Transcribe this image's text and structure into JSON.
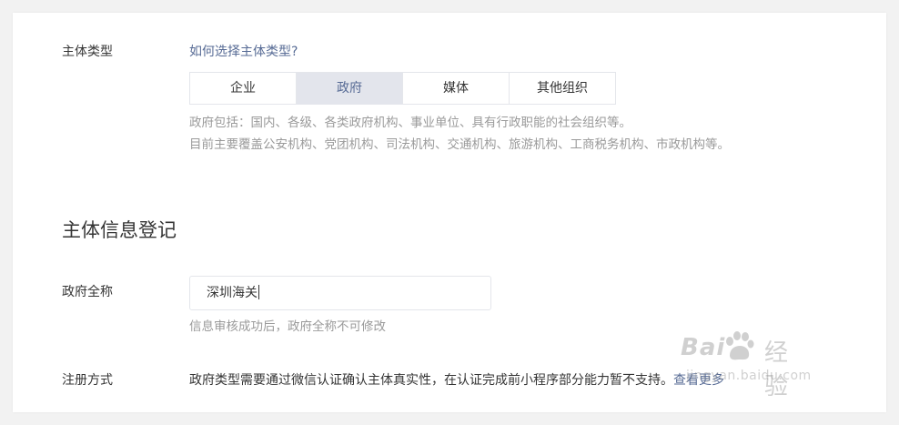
{
  "entity_type": {
    "label": "主体类型",
    "help_link": "如何选择主体类型?",
    "tabs": [
      "企业",
      "政府",
      "媒体",
      "其他组织"
    ],
    "active_tab": "政府",
    "hint_line1": "政府包括：国内、各级、各类政府机构、事业单位、具有行政职能的社会组织等。",
    "hint_line2": "目前主要覆盖公安机构、党团机构、司法机构、交通机构、旅游机构、工商税务机构、市政机构等。"
  },
  "registration": {
    "section_title": "主体信息登记",
    "full_name_label": "政府全称",
    "full_name_value": "深圳海关",
    "full_name_hint": "信息审核成功后，政府全称不可修改",
    "method_label": "注册方式",
    "method_text": "政府类型需要通过微信认证确认主体真实性，在认证完成前小程序部分能力暂不支持。",
    "more_link": "查看更多"
  },
  "watermark": {
    "brand": "Bai",
    "brand_suffix": "经验",
    "url": "jingyan.baidu.com"
  },
  "colors": {
    "link": "#576b95",
    "active_tab_bg": "#e3e5ec",
    "hint": "#9a9a9a",
    "text": "#353535"
  }
}
